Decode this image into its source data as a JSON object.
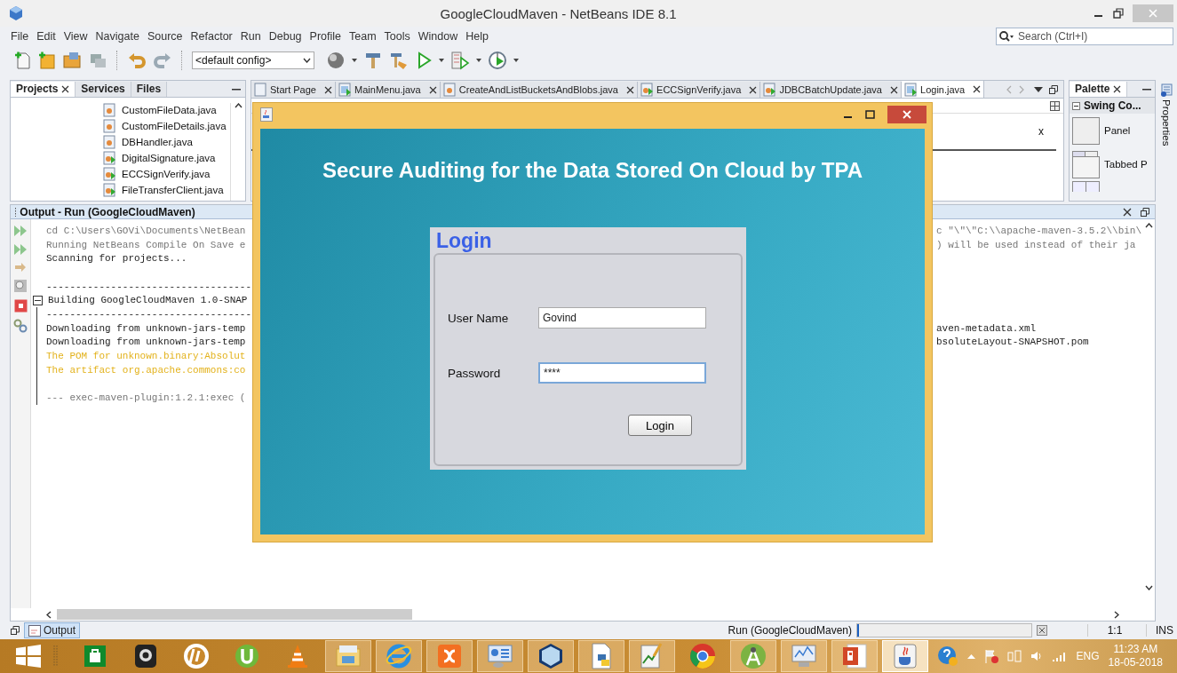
{
  "window": {
    "title": "GoogleCloudMaven - NetBeans IDE 8.1"
  },
  "menu": [
    "File",
    "Edit",
    "View",
    "Navigate",
    "Source",
    "Refactor",
    "Run",
    "Debug",
    "Profile",
    "Team",
    "Tools",
    "Window",
    "Help"
  ],
  "search": {
    "placeholder": "Search (Ctrl+I)"
  },
  "toolbar": {
    "config": "<default config>"
  },
  "projects_panel": {
    "tabs": [
      {
        "label": "Projects",
        "selected": true,
        "closable": true
      },
      {
        "label": "Services",
        "selected": false,
        "closable": false
      },
      {
        "label": "Files",
        "selected": false,
        "closable": false
      }
    ],
    "files": [
      {
        "name": "CustomFileData.java",
        "kind": "class"
      },
      {
        "name": "CustomFileDetails.java",
        "kind": "class"
      },
      {
        "name": "DBHandler.java",
        "kind": "class"
      },
      {
        "name": "DigitalSignature.java",
        "kind": "main"
      },
      {
        "name": "ECCSignVerify.java",
        "kind": "main"
      },
      {
        "name": "FileTransferClient.java",
        "kind": "main"
      }
    ]
  },
  "editor": {
    "tabs": [
      {
        "label": "Start Page",
        "kind": "page",
        "selected": false
      },
      {
        "label": "MainMenu.java",
        "kind": "form",
        "selected": false
      },
      {
        "label": "CreateAndListBucketsAndBlobs.java",
        "kind": "class",
        "selected": false
      },
      {
        "label": "ECCSignVerify.java",
        "kind": "main",
        "selected": false
      },
      {
        "label": "JDBCBatchUpdate.java",
        "kind": "main",
        "selected": false
      },
      {
        "label": "Login.java",
        "kind": "form",
        "selected": true
      }
    ],
    "design_text": "x"
  },
  "palette": {
    "title": "Palette",
    "category": "Swing Co...",
    "expanded": true,
    "items": [
      {
        "label": "Panel",
        "kind": "panel"
      },
      {
        "label": "Tabbed P",
        "kind": "tabbed"
      }
    ]
  },
  "properties_label": "Properties",
  "output": {
    "title": "Output - Run (GoogleCloudMaven)",
    "lines": [
      {
        "kind": "text",
        "color": "#777777",
        "text": "cd C:\\Users\\GOVi\\Documents\\NetBean",
        "right": "c \"\\\"\\\"C:\\\\apache-maven-3.5.2\\\\bin\\"
      },
      {
        "kind": "text",
        "color": "#777777",
        "text": "Running NetBeans Compile On Save e",
        "right": ") will be used instead of their ja"
      },
      {
        "kind": "text",
        "color": "#222222",
        "text": "Scanning for projects..."
      },
      {
        "kind": "blank"
      },
      {
        "kind": "text",
        "text": "-----------------------------------"
      },
      {
        "kind": "fold",
        "expanded": true,
        "color": "#222222",
        "text": "Building GoogleCloudMaven 1.0-SNAP",
        "children": [
          {
            "kind": "text",
            "text": "-----------------------------------"
          },
          {
            "kind": "text",
            "color": "#222222",
            "text": "Downloading from unknown-jars-temp",
            "right": "aven-metadata.xml"
          },
          {
            "kind": "text",
            "color": "#222222",
            "text": "Downloading from unknown-jars-temp",
            "right": "bsoluteLayout-SNAPSHOT.pom"
          },
          {
            "kind": "text",
            "color": "#e3b21c",
            "text": "The POM for unknown.binary:Absolut"
          },
          {
            "kind": "text",
            "color": "#e3b21c",
            "text": "The artifact org.apache.commons:co"
          },
          {
            "kind": "blank"
          },
          {
            "kind": "text",
            "color": "#777777",
            "text": "--- exec-maven-plugin:1.2.1:exec ("
          }
        ]
      }
    ]
  },
  "status_bar": {
    "output_tab": {
      "label": "Output",
      "selected": true
    },
    "task": "Run (GoogleCloudMaven)",
    "progress": {
      "level": 0.01
    },
    "position": "1:1",
    "mode": "INS"
  },
  "dialog": {
    "heading": "Secure Auditing for the Data Stored On Cloud by TPA",
    "login": {
      "title": "Login",
      "fields": [
        {
          "label": "User Name",
          "value": "Govind",
          "focused": false
        },
        {
          "label": "Password",
          "value": "****",
          "focused": true
        }
      ],
      "button": "Login"
    }
  },
  "taskbar": {
    "apps": [
      {
        "kind": "store",
        "running": false,
        "selected": false
      },
      {
        "kind": "webcam",
        "running": false,
        "selected": false
      },
      {
        "kind": "hp",
        "running": false,
        "selected": false
      },
      {
        "kind": "torrent",
        "running": false,
        "selected": false
      },
      {
        "kind": "cone",
        "running": false,
        "selected": false
      },
      {
        "kind": "explorer",
        "running": true,
        "selected": false
      },
      {
        "kind": "ie",
        "running": true,
        "selected": false
      },
      {
        "kind": "xampp",
        "running": true,
        "selected": false
      },
      {
        "kind": "control",
        "running": true,
        "selected": false
      },
      {
        "kind": "cube",
        "running": true,
        "selected": false
      },
      {
        "kind": "python",
        "running": true,
        "selected": false
      },
      {
        "kind": "notepad",
        "running": true,
        "selected": false
      },
      {
        "kind": "chrome",
        "running": false,
        "selected": false
      },
      {
        "kind": "android",
        "running": true,
        "selected": false
      },
      {
        "kind": "monitor",
        "running": true,
        "selected": false
      },
      {
        "kind": "ppt",
        "running": true,
        "selected": false
      },
      {
        "kind": "java",
        "running": true,
        "selected": true
      }
    ],
    "language": "ENG",
    "time": "11:23 AM",
    "date": "18-05-2018"
  }
}
